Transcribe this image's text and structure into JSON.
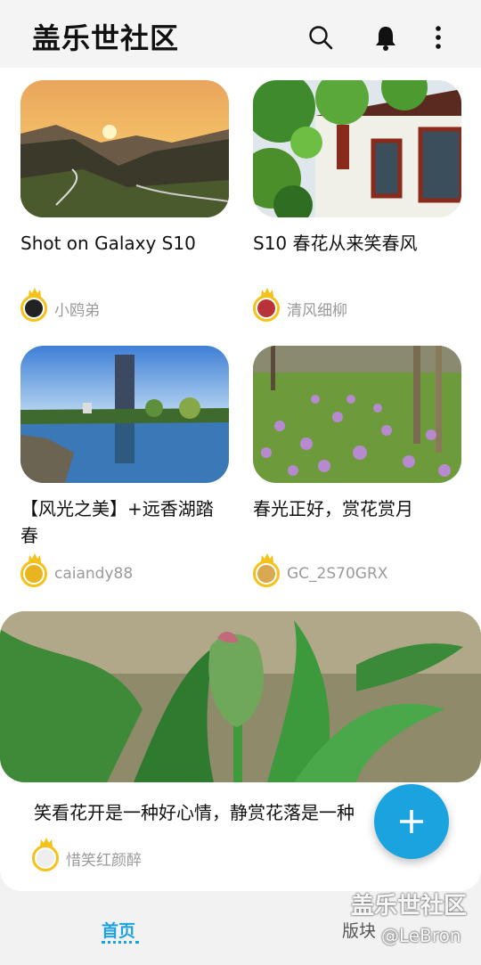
{
  "header": {
    "title": "盖乐世社区",
    "icons": [
      "search-icon",
      "bell-icon",
      "more-vertical-icon"
    ]
  },
  "posts": [
    {
      "title": "Shot on Galaxy S10",
      "author": "小鸥弟",
      "image": "sunset-valley-photo"
    },
    {
      "title": "S10 春花从来笑春风",
      "author": "清风细柳",
      "image": "house-and-branches-photo"
    },
    {
      "title": "【风光之美】+远香湖踏春",
      "author": "caiandy88",
      "image": "lake-tower-photo"
    },
    {
      "title": "春光正好，赏花赏月",
      "author": "GC_2S70GRX",
      "image": "purple-flowers-photo"
    }
  ],
  "featured": {
    "title": "笑看花开是一种好心情，静赏花落是一种",
    "author": "惜笑红颜醉",
    "image": "tulip-bud-photo"
  },
  "fab": {
    "icon": "plus-icon",
    "color": "#1aa3df"
  },
  "nav": {
    "home": "首页",
    "boards": "版块"
  },
  "watermark": {
    "line1": "盖乐世社区",
    "line2": "@LeBron"
  },
  "colors": {
    "accent": "#1aa3df",
    "crown": "#f4c21a"
  }
}
